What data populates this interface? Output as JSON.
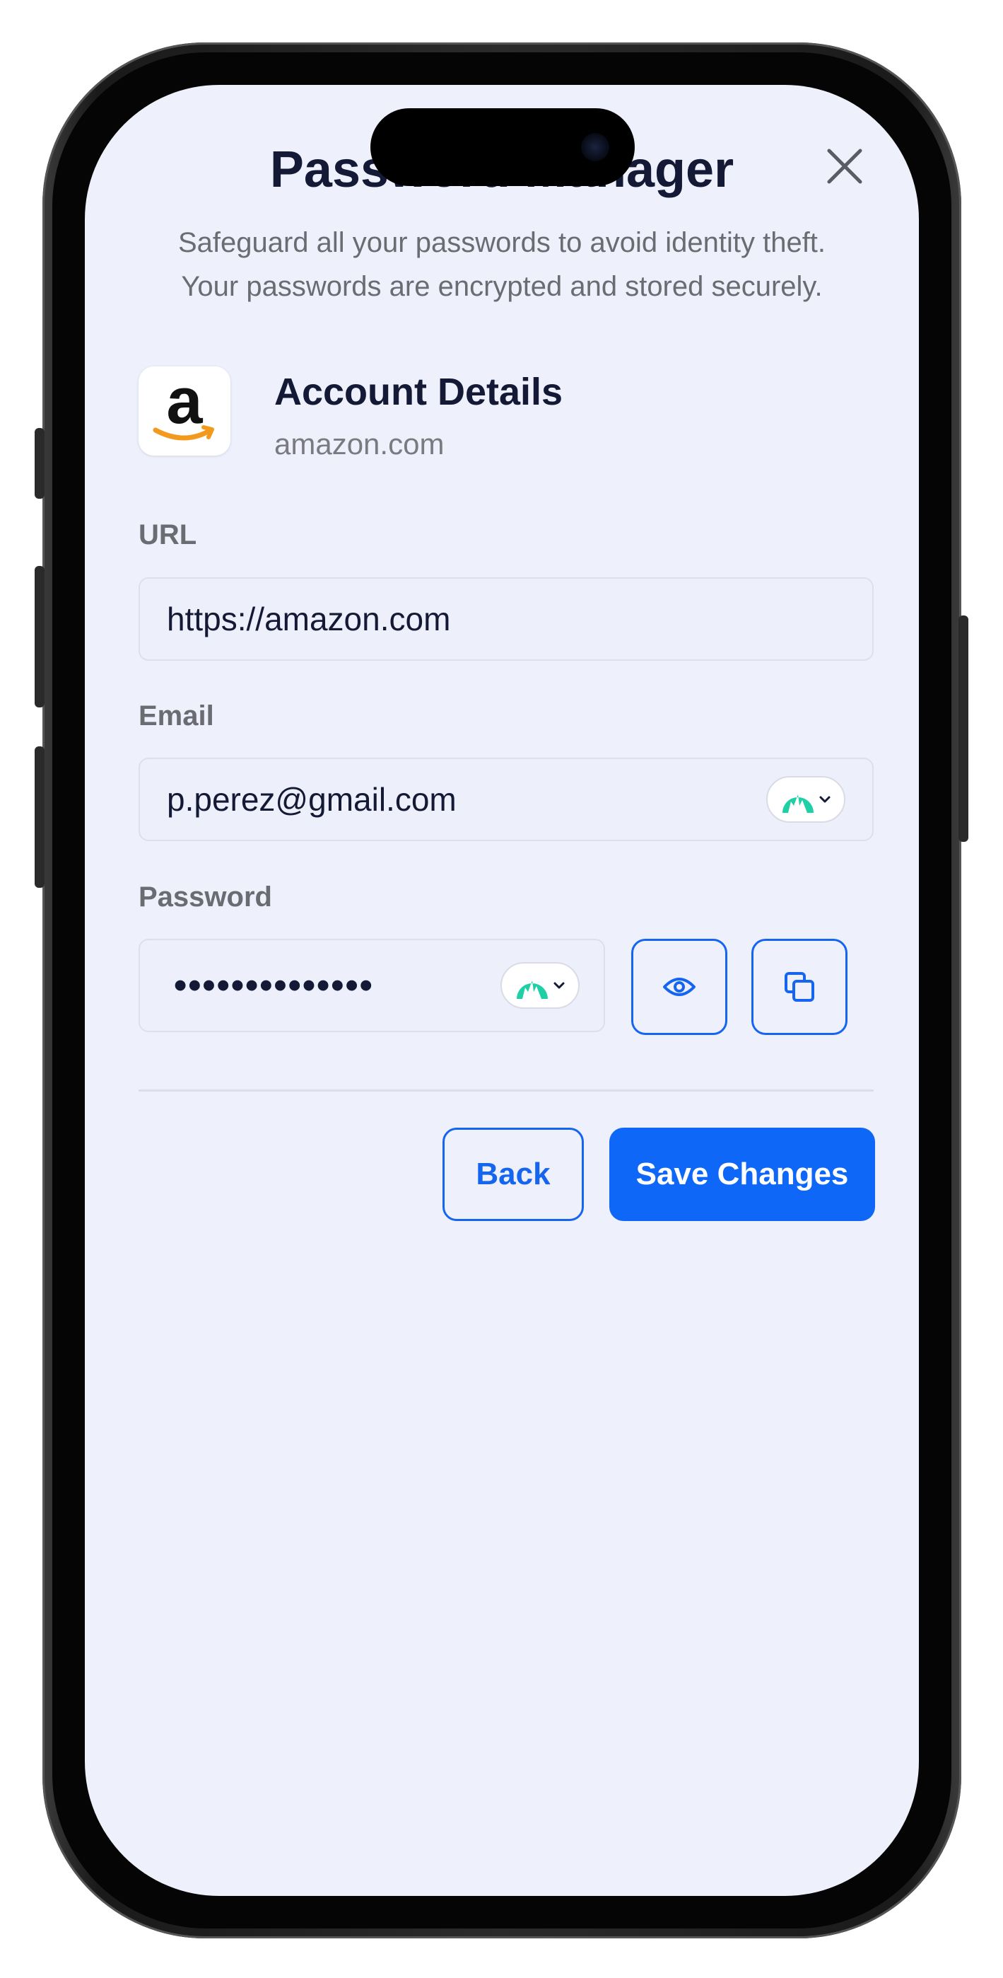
{
  "header": {
    "title": "Password Manager",
    "subtitle_line1": "Safeguard all your passwords to avoid identity theft.",
    "subtitle_line2": "Your passwords are encrypted and stored securely."
  },
  "account": {
    "title": "Account Details",
    "domain": "amazon.com",
    "logo_letter": "a"
  },
  "form": {
    "url_label": "URL",
    "url_value": "https://amazon.com",
    "email_label": "Email",
    "email_value": "p.perez@gmail.com",
    "password_label": "Password",
    "password_value": "••••••••••••••"
  },
  "actions": {
    "back_label": "Back",
    "save_label": "Save Changes"
  },
  "colors": {
    "accent": "#0f67f7",
    "screen_background": "#eef1fc",
    "extension_teal": "#1fcfa6"
  },
  "icons": {
    "close": "close-icon",
    "extension": "nordpass-mountain-icon",
    "reveal": "eye-icon",
    "copy": "copy-icon"
  }
}
